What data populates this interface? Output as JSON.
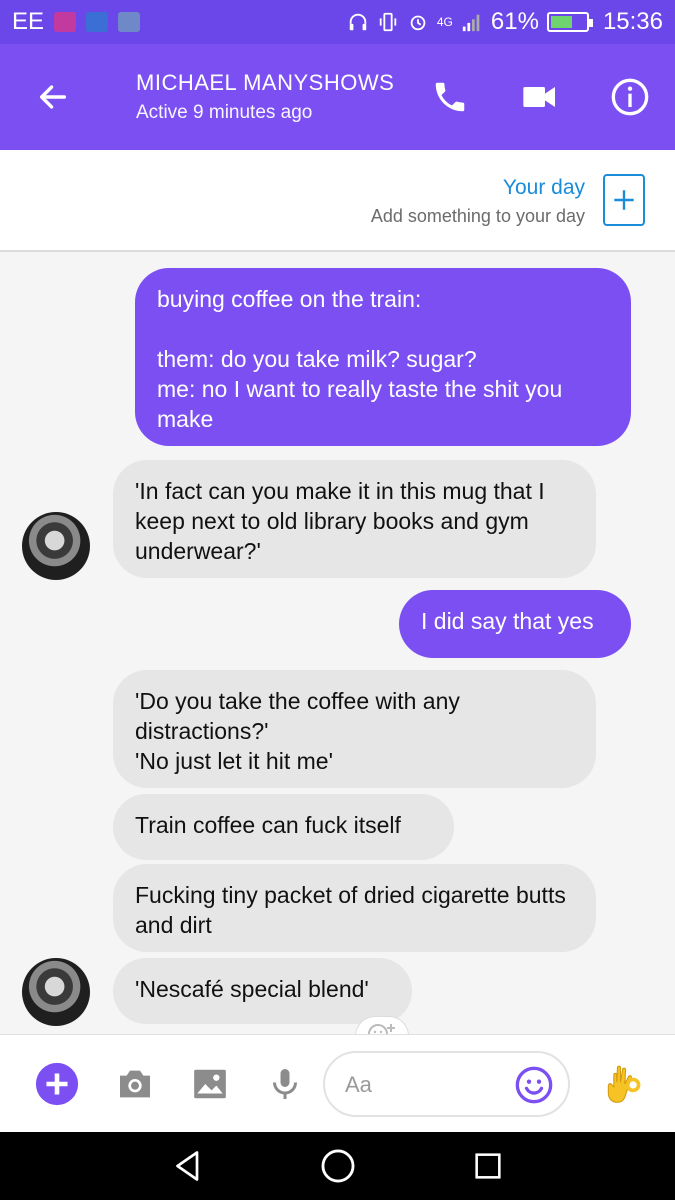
{
  "status_bar": {
    "carrier": "EE",
    "network": "4G",
    "battery": "61%",
    "time": "15:36",
    "battery_level": 0.61
  },
  "header": {
    "name": "MICHAEL MANYSHOWS",
    "status": "Active 9 minutes ago"
  },
  "your_day": {
    "title": "Your day",
    "subtitle": "Add something to your day"
  },
  "messages": [
    {
      "text": "buying coffee on the train:\n\nthem: do you take milk? sugar?\nme: no I want to really taste the shit you make"
    },
    {
      "text": "'In fact can you make it in this mug that I keep next to old library books and gym underwear?'"
    },
    {
      "text": "I did say that yes"
    },
    {
      "text": "'Do you take the coffee with any distractions?'\n'No just let it hit me'"
    },
    {
      "text": "Train coffee can fuck itself"
    },
    {
      "text": "Fucking tiny packet of dried cigarette butts and dirt"
    },
    {
      "text": "'Nescafé special blend'"
    }
  ],
  "composer": {
    "placeholder": "Aa"
  },
  "colors": {
    "accent": "#7b4ff2",
    "status_bar": "#6b46e8",
    "incoming_bubble": "#e6e6e6",
    "link_blue": "#1a8cd8"
  },
  "icons": {
    "back": "arrow-left-icon",
    "call": "phone-icon",
    "video": "video-camera-icon",
    "info": "info-icon",
    "add_day": "plus-icon",
    "add": "plus-circle-icon",
    "camera": "camera-icon",
    "gallery": "image-icon",
    "mic": "microphone-icon",
    "emoji": "smiley-icon",
    "reaction": "ok-hand-icon"
  }
}
